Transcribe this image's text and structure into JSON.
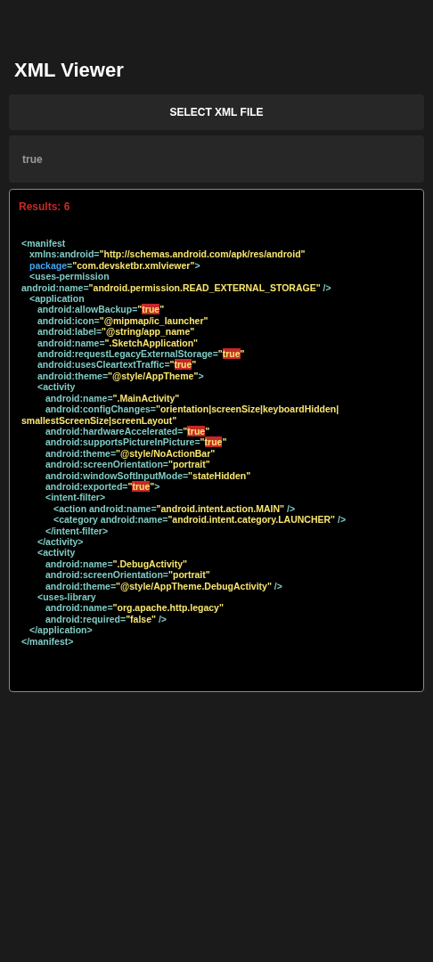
{
  "title": "XML Viewer",
  "select_button": {
    "label": "SELECT XML FILE"
  },
  "search": {
    "value": "true"
  },
  "results": {
    "label": "Results: 6",
    "xml": [
      {
        "segments": [
          {
            "text": "<manifest",
            "kind": "markup"
          }
        ],
        "children": [
          {
            "segments": [
              {
                "text": "xmlns:android=",
                "kind": "markup"
              },
              {
                "text": "\"http://schemas.android.com/apk/res/android\"",
                "kind": "value"
              }
            ]
          },
          {
            "segments": [
              {
                "text": "package",
                "kind": "keyword"
              },
              {
                "text": "=",
                "kind": "markup"
              },
              {
                "text": "\"com.devsketbr.xmlviewer\"",
                "kind": "value"
              },
              {
                "text": ">",
                "kind": "markup"
              }
            ]
          },
          {
            "segments": [
              {
                "text": "<uses-permission",
                "kind": "markup"
              }
            ],
            "wrap": [
              {
                "text": "android:name=",
                "kind": "markup"
              },
              {
                "text": "\"android.permission.READ_EXTERNAL_STORAGE\"",
                "kind": "value"
              },
              {
                "text": " />",
                "kind": "markup"
              }
            ]
          },
          {
            "segments": [
              {
                "text": "<application",
                "kind": "markup"
              }
            ],
            "children": [
              {
                "segments": [
                  {
                    "text": "android:allowBackup=",
                    "kind": "markup"
                  },
                  {
                    "text": "\"",
                    "kind": "value"
                  },
                  {
                    "text": "true",
                    "kind": "match"
                  },
                  {
                    "text": "\"",
                    "kind": "value"
                  }
                ]
              },
              {
                "segments": [
                  {
                    "text": "android:icon=",
                    "kind": "markup"
                  },
                  {
                    "text": "\"@mipmap/ic_launcher\"",
                    "kind": "value"
                  }
                ]
              },
              {
                "segments": [
                  {
                    "text": "android:label=",
                    "kind": "markup"
                  },
                  {
                    "text": "\"@string/app_name\"",
                    "kind": "value"
                  }
                ]
              },
              {
                "segments": [
                  {
                    "text": "android:name=",
                    "kind": "markup"
                  },
                  {
                    "text": "\".SketchApplication\"",
                    "kind": "value"
                  }
                ]
              },
              {
                "segments": [
                  {
                    "text": "android:requestLegacyExternalStorage=",
                    "kind": "markup"
                  },
                  {
                    "text": "\"",
                    "kind": "value"
                  },
                  {
                    "text": "true",
                    "kind": "match"
                  },
                  {
                    "text": "\"",
                    "kind": "value"
                  }
                ]
              },
              {
                "segments": [
                  {
                    "text": "android:usesCleartextTraffic=",
                    "kind": "markup"
                  },
                  {
                    "text": "\"",
                    "kind": "value"
                  },
                  {
                    "text": "true",
                    "kind": "match"
                  },
                  {
                    "text": "\"",
                    "kind": "value"
                  }
                ]
              },
              {
                "segments": [
                  {
                    "text": "android:theme=",
                    "kind": "markup"
                  },
                  {
                    "text": "\"@style/AppTheme\"",
                    "kind": "value"
                  },
                  {
                    "text": ">",
                    "kind": "markup"
                  }
                ]
              },
              {
                "segments": [
                  {
                    "text": "<activity",
                    "kind": "markup"
                  }
                ],
                "children": [
                  {
                    "segments": [
                      {
                        "text": "android:name=",
                        "kind": "markup"
                      },
                      {
                        "text": "\".MainActivity\"",
                        "kind": "value"
                      }
                    ]
                  },
                  {
                    "segments": [
                      {
                        "text": "android:configChanges=",
                        "kind": "markup"
                      },
                      {
                        "text": "\"orientation|screenSize|keyboardHidden|",
                        "kind": "value"
                      }
                    ],
                    "wrap": [
                      {
                        "text": "smallestScreenSize|screenLayout\"",
                        "kind": "value"
                      }
                    ]
                  },
                  {
                    "segments": [
                      {
                        "text": "android:hardwareAccelerated=",
                        "kind": "markup"
                      },
                      {
                        "text": "\"",
                        "kind": "value"
                      },
                      {
                        "text": "true",
                        "kind": "match"
                      },
                      {
                        "text": "\"",
                        "kind": "value"
                      }
                    ]
                  },
                  {
                    "segments": [
                      {
                        "text": "android:supportsPictureInPicture=",
                        "kind": "markup"
                      },
                      {
                        "text": "\"",
                        "kind": "value"
                      },
                      {
                        "text": "true",
                        "kind": "match"
                      },
                      {
                        "text": "\"",
                        "kind": "value"
                      }
                    ]
                  },
                  {
                    "segments": [
                      {
                        "text": "android:theme=",
                        "kind": "markup"
                      },
                      {
                        "text": "\"@style/NoActionBar\"",
                        "kind": "value"
                      }
                    ]
                  },
                  {
                    "segments": [
                      {
                        "text": "android:screenOrientation=",
                        "kind": "markup"
                      },
                      {
                        "text": "\"portrait\"",
                        "kind": "value"
                      }
                    ]
                  },
                  {
                    "segments": [
                      {
                        "text": "android:windowSoftInputMode=",
                        "kind": "markup"
                      },
                      {
                        "text": "\"stateHidden\"",
                        "kind": "value"
                      }
                    ]
                  },
                  {
                    "segments": [
                      {
                        "text": "android:exported=",
                        "kind": "markup"
                      },
                      {
                        "text": "\"",
                        "kind": "value"
                      },
                      {
                        "text": "true",
                        "kind": "match"
                      },
                      {
                        "text": "\"",
                        "kind": "value"
                      },
                      {
                        "text": ">",
                        "kind": "markup"
                      }
                    ]
                  },
                  {
                    "segments": [
                      {
                        "text": "<intent-filter>",
                        "kind": "markup"
                      }
                    ],
                    "children": [
                      {
                        "segments": [
                          {
                            "text": "<action android:name=",
                            "kind": "markup"
                          },
                          {
                            "text": "\"android.intent.action.MAIN\"",
                            "kind": "value"
                          },
                          {
                            "text": " />",
                            "kind": "markup"
                          }
                        ]
                      },
                      {
                        "segments": [
                          {
                            "text": "<category android:name=",
                            "kind": "markup"
                          },
                          {
                            "text": "\"android.intent.category.LAUNCHER\"",
                            "kind": "value"
                          },
                          {
                            "text": " />",
                            "kind": "markup"
                          }
                        ]
                      }
                    ]
                  },
                  {
                    "segments": [
                      {
                        "text": "</intent-filter>",
                        "kind": "markup"
                      }
                    ]
                  }
                ]
              },
              {
                "segments": [
                  {
                    "text": "</activity>",
                    "kind": "markup"
                  }
                ]
              },
              {
                "segments": [
                  {
                    "text": "<activity",
                    "kind": "markup"
                  }
                ],
                "children": [
                  {
                    "segments": [
                      {
                        "text": "android:name=",
                        "kind": "markup"
                      },
                      {
                        "text": "\".DebugActivity\"",
                        "kind": "value"
                      }
                    ]
                  },
                  {
                    "segments": [
                      {
                        "text": "android:screenOrientation=",
                        "kind": "markup"
                      },
                      {
                        "text": "\"portrait\"",
                        "kind": "value"
                      }
                    ]
                  },
                  {
                    "segments": [
                      {
                        "text": "android:theme=",
                        "kind": "markup"
                      },
                      {
                        "text": "\"@style/AppTheme.DebugActivity\"",
                        "kind": "value"
                      },
                      {
                        "text": " />",
                        "kind": "markup"
                      }
                    ]
                  }
                ]
              },
              {
                "segments": [
                  {
                    "text": "<uses-library",
                    "kind": "markup"
                  }
                ],
                "children": [
                  {
                    "segments": [
                      {
                        "text": "android:name=",
                        "kind": "markup"
                      },
                      {
                        "text": "\"org.apache.http.legacy\"",
                        "kind": "value"
                      }
                    ]
                  },
                  {
                    "segments": [
                      {
                        "text": "android:required=",
                        "kind": "markup"
                      },
                      {
                        "text": "\"false\"",
                        "kind": "value"
                      },
                      {
                        "text": " />",
                        "kind": "markup"
                      }
                    ]
                  }
                ]
              }
            ]
          },
          {
            "segments": [
              {
                "text": "</application>",
                "kind": "markup"
              }
            ]
          }
        ]
      },
      {
        "segments": [
          {
            "text": "</manifest>",
            "kind": "markup"
          }
        ]
      }
    ]
  }
}
